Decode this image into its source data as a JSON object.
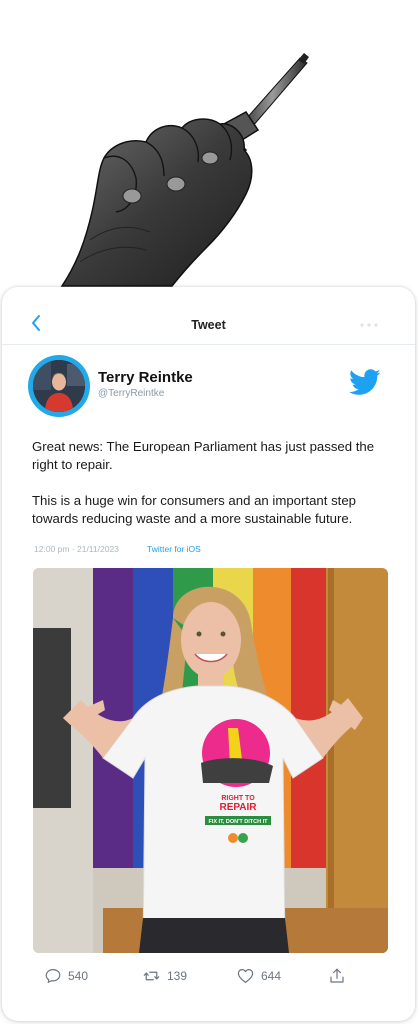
{
  "header": {
    "title": "Tweet"
  },
  "author": {
    "name": "Terry Reintke",
    "handle": "@TerryReintke"
  },
  "tweet": {
    "paragraphs": [
      "Great news: The European Parliament has just passed the right to repair.",
      "This is a huge win for consumers and an important step towards reducing waste and a more sustainable future."
    ],
    "timestamp": "12:00 pm · 21/11/2023",
    "source": "Twitter for iOS"
  },
  "shirt_print": {
    "line1": "RIGHT TO",
    "line2": "REPAIR",
    "banner": "FIX IT, DON'T DITCH IT"
  },
  "stats": {
    "replies": "540",
    "retweets": "139",
    "likes": "644"
  },
  "colors": {
    "accent": "#1da1f2",
    "avatar_ring": "#23a9e8"
  }
}
